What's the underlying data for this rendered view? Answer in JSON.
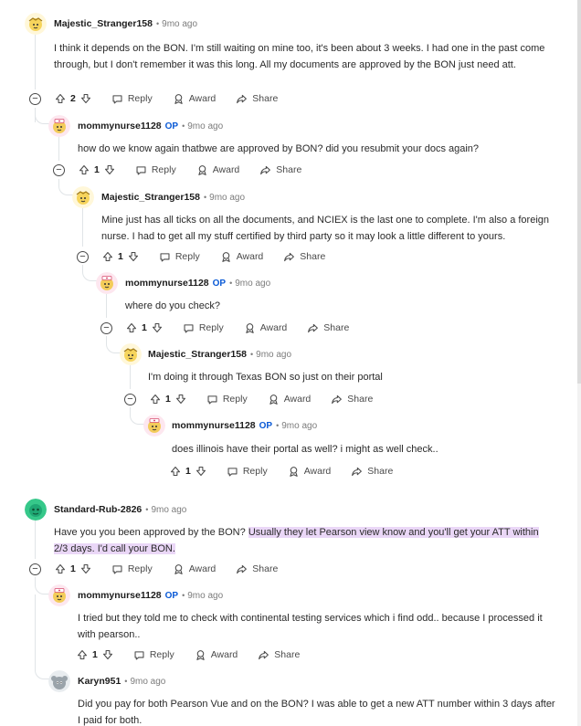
{
  "labels": {
    "reply": "Reply",
    "award": "Award",
    "share": "Share",
    "op": "OP"
  },
  "comments": [
    {
      "author": "Majestic_Stranger158",
      "time": "9mo ago",
      "score": "2",
      "text": "I think it depends on the BON. I'm still waiting on mine too, it's been about 3 weeks. I had one in the past come through, but I don't remember it was this long. All my documents are approved by the BON just need att."
    },
    {
      "author": "mommynurse1128",
      "time": "9mo ago",
      "score": "1",
      "text": "how do we know again thatbwe are approved by BON? did you resubmit your docs again?"
    },
    {
      "author": "Majestic_Stranger158",
      "time": "9mo ago",
      "score": "1",
      "text": "Mine just has all ticks on all the documents, and NCIEX is the last one to complete. I'm also a foreign nurse. I had to get all my stuff certified by third party so it may look a little different to yours."
    },
    {
      "author": "mommynurse1128",
      "time": "9mo ago",
      "score": "1",
      "text": "where do you check?"
    },
    {
      "author": "Majestic_Stranger158",
      "time": "9mo ago",
      "score": "1",
      "text": "I'm doing it through Texas BON so just on their portal"
    },
    {
      "author": "mommynurse1128",
      "time": "9mo ago",
      "score": "1",
      "text": "does illinois have their portal as well? i might as well check.."
    },
    {
      "author": "Standard-Rub-2826",
      "time": "9mo ago",
      "score": "1",
      "text_a": "Have you you been approved by the BON? ",
      "text_b": "Usually they let Pearson view know and you'll get your ATT within 2/3 days. I'd call your BON."
    },
    {
      "author": "mommynurse1128",
      "time": "9mo ago",
      "score": "1",
      "text": "I tried but they told me to check with continental testing services which i find odd.. because I processed it with pearson.."
    },
    {
      "author": "Karyn951",
      "time": "9mo ago",
      "text": "Did you pay for both Pearson Vue and on the BON? I was able to get a new ATT number within 3 days after I paid for both."
    }
  ]
}
